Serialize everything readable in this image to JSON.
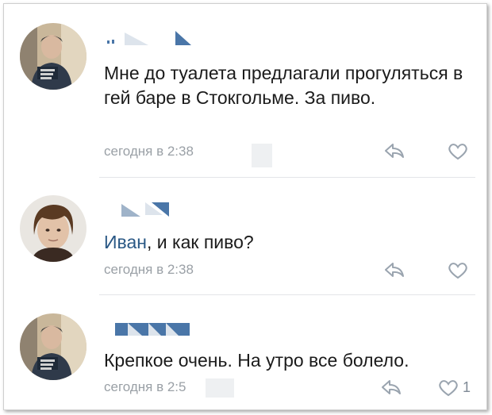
{
  "colors": {
    "text": "#1b1b1b",
    "meta": "#9aa0a6",
    "link": "#2a5885",
    "author_censor": "#4a76a8",
    "divider": "#e3e5e8"
  },
  "icons": {
    "reply": "reply-icon",
    "like": "heart-icon"
  },
  "comments": [
    {
      "text": "Мне до туалета предлагали прогуляться в гей баре в Стокгольме. За пиво.",
      "time": "сегодня в 2:38"
    },
    {
      "mention": "Иван",
      "text": ", и как пиво?",
      "time": "сегодня в 2:38"
    },
    {
      "text": "Крепкое очень. На утро все болело.",
      "time": "сегодня в 2:5",
      "likes": "1"
    }
  ]
}
